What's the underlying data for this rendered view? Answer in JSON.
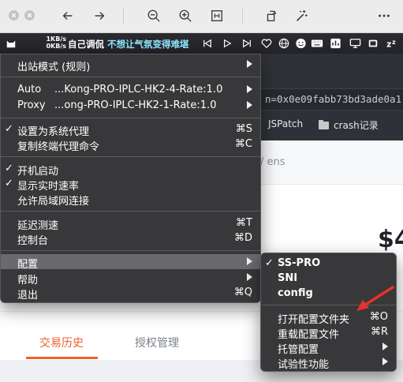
{
  "toolbar": {
    "icons": [
      "close-icon",
      "minimize-icon",
      "back-arrow-icon",
      "forward-arrow-icon",
      "zoom-out-icon",
      "zoom-in-icon",
      "fit-page-icon",
      "rotate-icon",
      "magic-wand-icon",
      "more-icon"
    ]
  },
  "menubar": {
    "speed_up": "1KB/s",
    "speed_down": "0KB/s",
    "ticker_part1": "自己调侃 ",
    "ticker_part2": "不想让气氛变得难堪",
    "icons": [
      "clash-cat-icon",
      "previous-track-icon",
      "play-icon",
      "next-track-icon",
      "heart-icon",
      "globe-icon",
      "emoji-icon",
      "keyboard-icon",
      "dashboard-icon",
      "monitor-icon",
      "sleep-icon"
    ]
  },
  "background": {
    "url": "n=0x0e09fabb73bd3ade0a1",
    "bookmarks": [
      "JSPatch",
      "crash记录"
    ],
    "breadcrumb": "/ ens",
    "price": "$4",
    "tabs": [
      "交易历史",
      "授权管理"
    ],
    "active_tab_color": "#f0602e"
  },
  "main_menu": {
    "outbound_mode": "出站模式 (规则)",
    "auto_label": "Auto",
    "auto_value": "...Kong-PRO-IPLC-HK2-4-Rate:1.0",
    "proxy_label": "Proxy",
    "proxy_value": "...ong-PRO-IPLC-HK2-1-Rate:1.0",
    "set_system_proxy": "设置为系统代理",
    "set_system_proxy_shortcut": "⌘S",
    "copy_terminal_cmd": "复制终端代理命令",
    "copy_terminal_cmd_shortcut": "⌘C",
    "launch_at_login": "开机启动",
    "show_speed": "显示实时速率",
    "allow_lan": "允许局域网连接",
    "latency_test": "延迟测速",
    "latency_test_shortcut": "⌘T",
    "dashboard": "控制台",
    "dashboard_shortcut": "⌘D",
    "config": "配置",
    "help": "帮助",
    "quit": "退出",
    "quit_shortcut": "⌘Q",
    "checkmark": "✓"
  },
  "sub_menu": {
    "profile_1": "SS-PRO",
    "profile_2": "SNI",
    "profile_3": "config",
    "open_config_folder": "打开配置文件夹",
    "open_config_folder_shortcut": "⌘O",
    "reload_config": "重载配置文件",
    "reload_config_shortcut": "⌘R",
    "managed_config": "托管配置",
    "experimental": "试验性功能"
  },
  "colors": {
    "menu_bg": "#323234",
    "highlight": "#6a6a6e",
    "annotation_arrow": "#e8322a"
  }
}
